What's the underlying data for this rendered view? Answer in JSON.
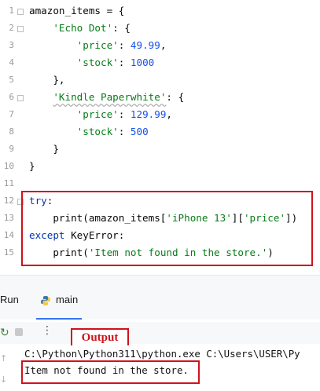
{
  "editor": {
    "line_numbers": [
      "1",
      "2",
      "3",
      "4",
      "5",
      "6",
      "7",
      "8",
      "9",
      "10",
      "11",
      "12",
      "13",
      "14",
      "15"
    ],
    "lines": [
      [
        {
          "t": "amazon_items = {",
          "c": ""
        }
      ],
      [
        {
          "t": "    ",
          "c": ""
        },
        {
          "t": "'Echo Dot'",
          "c": "str"
        },
        {
          "t": ": {",
          "c": ""
        }
      ],
      [
        {
          "t": "        ",
          "c": ""
        },
        {
          "t": "'price'",
          "c": "str"
        },
        {
          "t": ": ",
          "c": ""
        },
        {
          "t": "49.99",
          "c": "num"
        },
        {
          "t": ",",
          "c": ""
        }
      ],
      [
        {
          "t": "        ",
          "c": ""
        },
        {
          "t": "'stock'",
          "c": "str"
        },
        {
          "t": ": ",
          "c": ""
        },
        {
          "t": "1000",
          "c": "num"
        }
      ],
      [
        {
          "t": "    },",
          "c": ""
        }
      ],
      [
        {
          "t": "    ",
          "c": ""
        },
        {
          "t": "'Kindle Paperwhite'",
          "c": "str squig"
        },
        {
          "t": ": {",
          "c": ""
        }
      ],
      [
        {
          "t": "        ",
          "c": ""
        },
        {
          "t": "'price'",
          "c": "str"
        },
        {
          "t": ": ",
          "c": ""
        },
        {
          "t": "129.99",
          "c": "num"
        },
        {
          "t": ",",
          "c": ""
        }
      ],
      [
        {
          "t": "        ",
          "c": ""
        },
        {
          "t": "'stock'",
          "c": "str"
        },
        {
          "t": ": ",
          "c": ""
        },
        {
          "t": "500",
          "c": "num"
        }
      ],
      [
        {
          "t": "    }",
          "c": ""
        }
      ],
      [
        {
          "t": "}",
          "c": ""
        }
      ],
      [],
      [
        {
          "t": "try",
          "c": "kw"
        },
        {
          "t": ":",
          "c": ""
        }
      ],
      [
        {
          "t": "    print(amazon_items[",
          "c": ""
        },
        {
          "t": "'iPhone 13'",
          "c": "str"
        },
        {
          "t": "][",
          "c": ""
        },
        {
          "t": "'price'",
          "c": "str"
        },
        {
          "t": "])",
          "c": ""
        }
      ],
      [
        {
          "t": "except ",
          "c": "kw"
        },
        {
          "t": "KeyError:",
          "c": ""
        }
      ],
      [
        {
          "t": "    print(",
          "c": ""
        },
        {
          "t": "'Item not found in the store.'",
          "c": "str"
        },
        {
          "t": ")",
          "c": ""
        }
      ]
    ]
  },
  "run_panel": {
    "tool_window_label": "Run",
    "tab_label": "main",
    "more_label": "⋮",
    "output_badge": "Output"
  },
  "console": {
    "command_line": "C:\\Python\\Python311\\python.exe C:\\Users\\USER\\Py",
    "output_line": "Item not found in the store."
  },
  "colors": {
    "string": "#067d17",
    "number": "#1750eb",
    "keyword": "#0033b3",
    "highlight_border": "#d0121b",
    "tab_underline": "#3574f0"
  }
}
